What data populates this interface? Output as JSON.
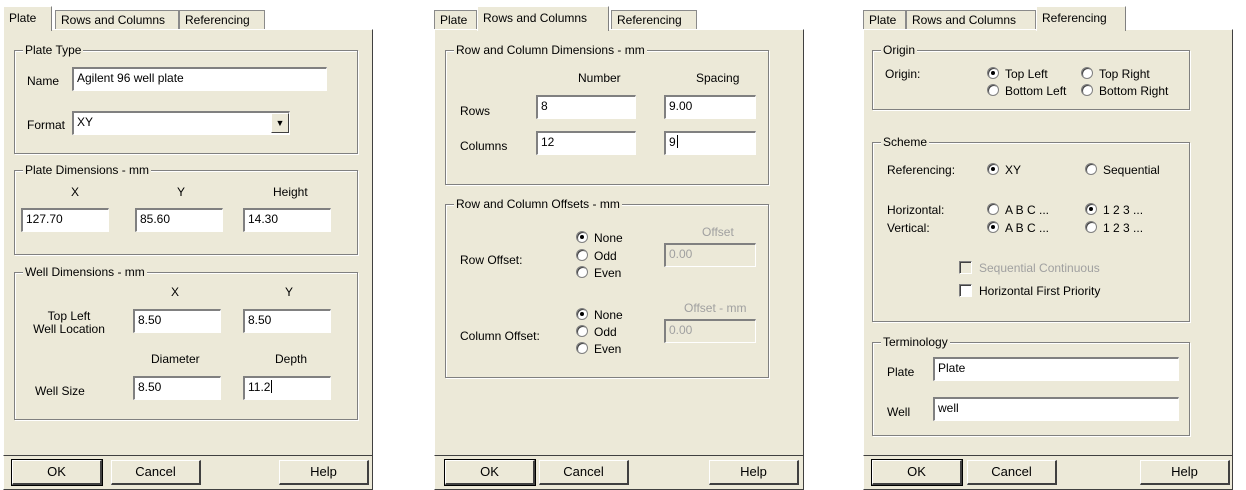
{
  "tabs": [
    "Plate",
    "Rows and Columns",
    "Referencing"
  ],
  "buttons": {
    "ok": "OK",
    "cancel": "Cancel",
    "help": "Help"
  },
  "plate_tab": {
    "plate_type": {
      "legend": "Plate Type",
      "name_label": "Name",
      "name_value": "Agilent 96 well plate",
      "format_label": "Format",
      "format_value": "XY"
    },
    "plate_dimensions": {
      "legend": "Plate Dimensions - mm",
      "x_label": "X",
      "y_label": "Y",
      "height_label": "Height",
      "x_value": "127.70",
      "y_value": "85.60",
      "height_value": "14.30"
    },
    "well_dimensions": {
      "legend": "Well Dimensions - mm",
      "x_label": "X",
      "y_label": "Y",
      "top_left_label_1": "Top Left",
      "top_left_label_2": "Well Location",
      "x_value": "8.50",
      "y_value": "8.50",
      "diameter_label": "Diameter",
      "depth_label": "Depth",
      "well_size_label": "Well Size",
      "diameter_value": "8.50",
      "depth_value": "11.2"
    }
  },
  "rows_tab": {
    "dimensions": {
      "legend": "Row and Column Dimensions - mm",
      "number_label": "Number",
      "spacing_label": "Spacing",
      "rows_label": "Rows",
      "rows_number": "8",
      "rows_spacing": "9.00",
      "columns_label": "Columns",
      "columns_number": "12",
      "columns_spacing": "9"
    },
    "offsets": {
      "legend": "Row and Column Offsets - mm",
      "row_offset_label": "Row Offset:",
      "column_offset_label": "Column Offset:",
      "none": "None",
      "odd": "Odd",
      "even": "Even",
      "offset_label": "Offset",
      "offset_mm_label": "Offset - mm",
      "row_offset_value": "0.00",
      "column_offset_value": "0.00"
    }
  },
  "ref_tab": {
    "origin": {
      "legend": "Origin",
      "label": "Origin:",
      "top_left": "Top Left",
      "top_right": "Top Right",
      "bottom_left": "Bottom Left",
      "bottom_right": "Bottom Right"
    },
    "scheme": {
      "legend": "Scheme",
      "referencing_label": "Referencing:",
      "xy": "XY",
      "sequential": "Sequential",
      "horizontal_label": "Horizontal:",
      "vertical_label": "Vertical:",
      "abc": "A B C ...",
      "num": "1 2 3 ...",
      "seq_continuous": "Sequential Continuous",
      "horiz_first": "Horizontal First Priority"
    },
    "terminology": {
      "legend": "Terminology",
      "plate_label": "Plate",
      "plate_value": "Plate",
      "well_label": "Well",
      "well_value": "well"
    }
  }
}
